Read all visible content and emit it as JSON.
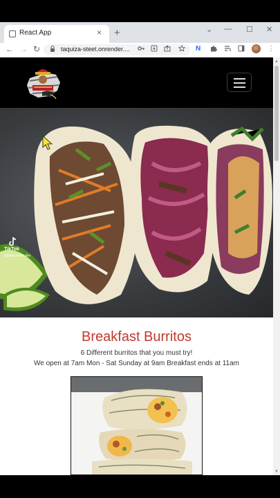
{
  "browser": {
    "tab_title": "React App",
    "tab_close": "×",
    "new_tab": "+",
    "minimize": "⌄",
    "restore": "—",
    "maximize": "☐",
    "close": "✕",
    "back": "←",
    "forward": "→",
    "reload": "↻",
    "url": "taquiza-steet.onrender....",
    "extension_letter": "N",
    "menu": "⋮"
  },
  "watermark": {
    "brand": "TikTok",
    "handle": "@dark.mode.dev"
  },
  "page": {
    "heading": "Breakfast Burritos",
    "subtitle": "6 Different burritos that you must try!",
    "hours": "We open at 7am Mon - Sat Sunday at 9am Breakfast ends at 11am"
  }
}
